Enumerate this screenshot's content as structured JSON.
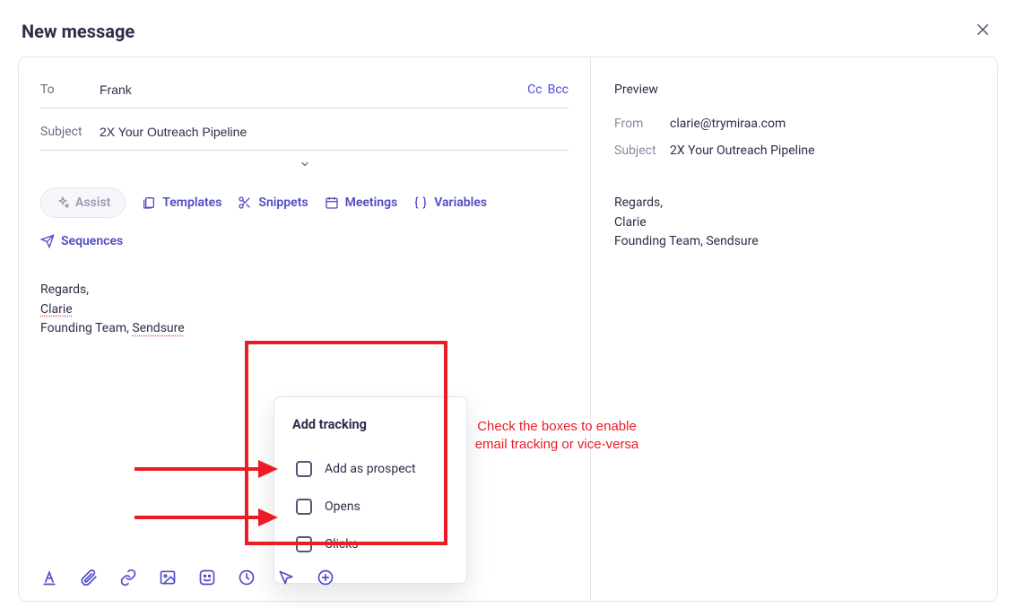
{
  "title": "New message",
  "compose": {
    "to_label": "To",
    "to_value": "Frank",
    "cc_label": "Cc",
    "bcc_label": "Bcc",
    "subject_label": "Subject",
    "subject_value": "2X Your Outreach Pipeline"
  },
  "toolbar": {
    "assist": "Assist",
    "templates": "Templates",
    "snippets": "Snippets",
    "meetings": "Meetings",
    "variables": "Variables",
    "sequences": "Sequences"
  },
  "body": {
    "regards": "Regards,",
    "name": "Clarie",
    "founding": "Founding Team, ",
    "company": "Sendsure"
  },
  "popover": {
    "title": "Add tracking",
    "opt1": "Add as prospect",
    "opt2": "Opens",
    "opt3": "Clicks"
  },
  "preview": {
    "title": "Preview",
    "from_label": "From",
    "from_value": "clarie@trymiraa.com",
    "subject_label": "Subject",
    "subject_value": "2X Your Outreach Pipeline",
    "regards": "Regards,",
    "name": "Clarie",
    "founding": "Founding Team, Sendsure"
  },
  "annotation": {
    "callout": "Check the boxes to enable email tracking or vice-versa"
  }
}
